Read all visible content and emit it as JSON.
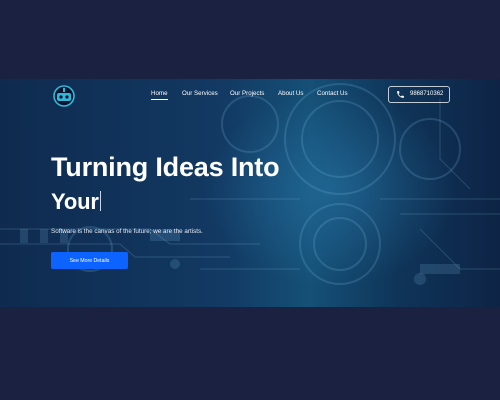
{
  "header": {
    "logo_icon": "robot-logo-icon",
    "nav": [
      {
        "label": "Home",
        "active": true
      },
      {
        "label": "Our Services",
        "active": false
      },
      {
        "label": "Our Projects",
        "active": false
      },
      {
        "label": "About Us",
        "active": false
      },
      {
        "label": "Contact Us",
        "active": false
      }
    ],
    "phone": {
      "icon": "phone-icon",
      "number": "9868710362"
    }
  },
  "hero": {
    "headline_line1": "Turning Ideas Into",
    "headline_line2": "Your",
    "tagline": "Software is the canvas of the future; we are the artists.",
    "cta_label": "See More Details"
  },
  "colors": {
    "page_bg": "#1b2141",
    "hero_bg": "#123a63",
    "accent": "#0d63ff",
    "text": "#ffffff"
  }
}
